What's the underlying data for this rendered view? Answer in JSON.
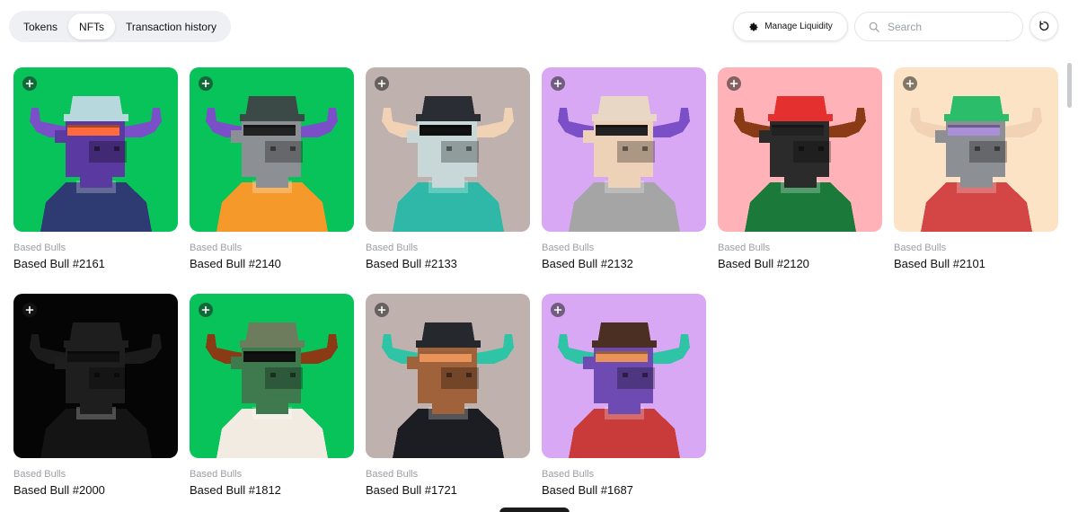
{
  "tabs": [
    {
      "label": "Tokens"
    },
    {
      "label": "NFTs",
      "active": true
    },
    {
      "label": "Transaction history"
    }
  ],
  "toolbar": {
    "manage_label": "Manage Liquidity",
    "search_placeholder": "Search"
  },
  "nfts": [
    {
      "collection": "Based Bulls",
      "name": "Based Bull #2161",
      "bg": "#08c25a",
      "horn": "#7b4fc7",
      "skin": "#5a3aa0",
      "hat": "#b7d9dd",
      "shirt": "#2e3a72",
      "eyes": "#ff6b3d"
    },
    {
      "collection": "Based Bulls",
      "name": "Based Bull #2140",
      "bg": "#08c25a",
      "horn": "#7b4fc7",
      "skin": "#8c8f94",
      "hat": "#3b4a47",
      "shirt": "#f59a2a",
      "eyes": "#222222"
    },
    {
      "collection": "Based Bulls",
      "name": "Based Bull #2133",
      "bg": "#bfb1ae",
      "horn": "#f1d2b4",
      "skin": "#c8d8d8",
      "hat": "#2a2d33",
      "shirt": "#2fb8a8",
      "eyes": "#111111"
    },
    {
      "collection": "Based Bulls",
      "name": "Based Bull #2132",
      "bg": "#d9a8f5",
      "horn": "#7b4fc7",
      "skin": "#eed2b7",
      "hat": "#e9d7c5",
      "shirt": "#a5a5a5",
      "eyes": "#222222"
    },
    {
      "collection": "Based Bulls",
      "name": "Based Bull #2120",
      "bg": "#ffb3b8",
      "horn": "#8a3a14",
      "skin": "#2b2b2b",
      "hat": "#e53030",
      "shirt": "#1b7a3a",
      "eyes": "#222222"
    },
    {
      "collection": "Based Bulls",
      "name": "Based Bull #2101",
      "bg": "#fde3c6",
      "horn": "#f1d2b4",
      "skin": "#8c8f94",
      "hat": "#2bbd6a",
      "shirt": "#d44545",
      "eyes": "#a98ed8"
    },
    {
      "collection": "Based Bulls",
      "name": "Based Bull #2000",
      "bg": "#050505",
      "horn": "#1b1b1b",
      "skin": "#1e1e1e",
      "hat": "#1e1e1e",
      "shirt": "#141414",
      "eyes": "#111111"
    },
    {
      "collection": "Based Bulls",
      "name": "Based Bull #1812",
      "bg": "#08c25a",
      "horn": "#8a3a14",
      "skin": "#3f7a4f",
      "hat": "#6e7c5e",
      "shirt": "#f2ebe2",
      "eyes": "#111111"
    },
    {
      "collection": "Based Bulls",
      "name": "Based Bull #1721",
      "bg": "#bfb1ae",
      "horn": "#2fc4a6",
      "skin": "#a0623a",
      "hat": "#25292e",
      "shirt": "#1b1d22",
      "eyes": "#e9935a"
    },
    {
      "collection": "Based Bulls",
      "name": "Based Bull #1687",
      "bg": "#d9a8f5",
      "horn": "#2fc4a6",
      "skin": "#6d4bb3",
      "hat": "#4b2f22",
      "shirt": "#c93a3a",
      "eyes": "#e9935a"
    }
  ]
}
